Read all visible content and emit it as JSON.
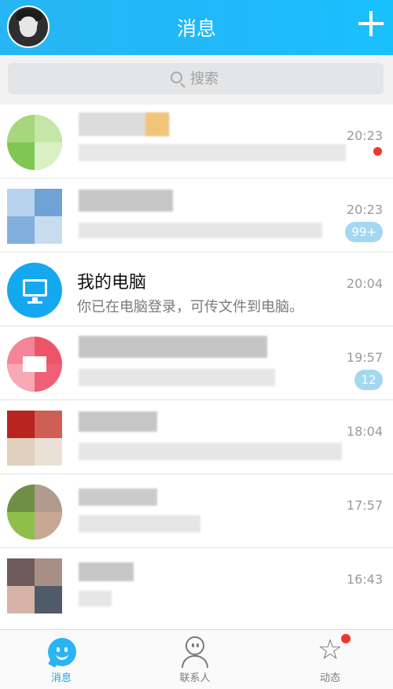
{
  "header": {
    "title": "消息",
    "add_label": "+"
  },
  "search": {
    "placeholder": "搜索"
  },
  "conversations": [
    {
      "name": "",
      "preview": "",
      "time": "20:23",
      "badge": "",
      "unread_dot": true
    },
    {
      "name": "",
      "preview": "",
      "time": "20:23",
      "badge": "99+"
    },
    {
      "name": "我的电脑",
      "preview": "你已在电脑登录，可传文件到电脑。",
      "time": "20:04",
      "badge": ""
    },
    {
      "name": "",
      "preview": "",
      "time": "19:57",
      "badge": "12"
    },
    {
      "name": "",
      "preview": "",
      "time": "18:04",
      "badge": ""
    },
    {
      "name": "",
      "preview": "",
      "time": "17:57",
      "badge": ""
    },
    {
      "name": "",
      "preview": "",
      "time": "16:43",
      "badge": ""
    }
  ],
  "tabbar": {
    "tabs": [
      {
        "label": "消息",
        "icon": "message-icon",
        "active": true
      },
      {
        "label": "联系人",
        "icon": "contacts-icon",
        "active": false
      },
      {
        "label": "动态",
        "icon": "star-icon",
        "active": false,
        "dot": true
      }
    ]
  },
  "colors": {
    "header": "#1fb9fa",
    "badge": "#a4d8f1",
    "unread": "#f1362a",
    "accent": "#1e9fe8"
  }
}
